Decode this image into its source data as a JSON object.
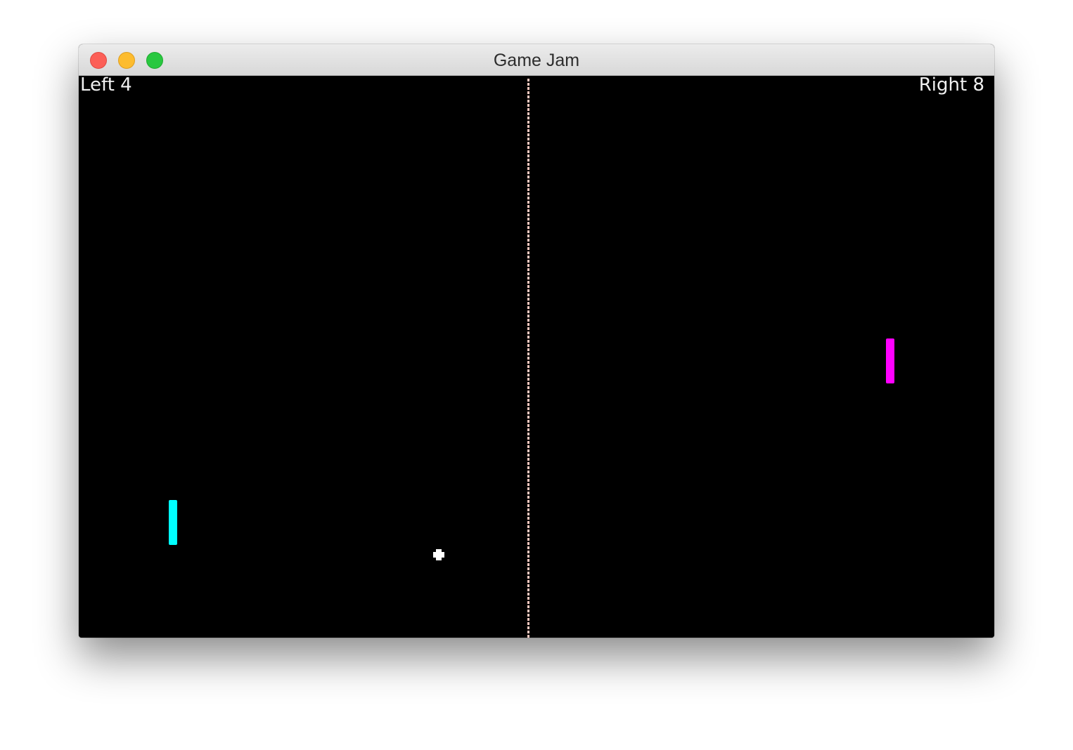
{
  "window": {
    "title": "Game Jam"
  },
  "scoreboard": {
    "left_label": "Left 4",
    "right_label": "Right 8"
  },
  "colors": {
    "left_paddle": "#00ffff",
    "right_paddle": "#ff00ff",
    "ball": "#ffffff",
    "net": "#f7c9c0",
    "field": "#000000"
  },
  "icons": {
    "close": "close-button-icon",
    "minimize": "minimize-button-icon",
    "zoom": "zoom-button-icon",
    "ball": "ball-icon"
  }
}
